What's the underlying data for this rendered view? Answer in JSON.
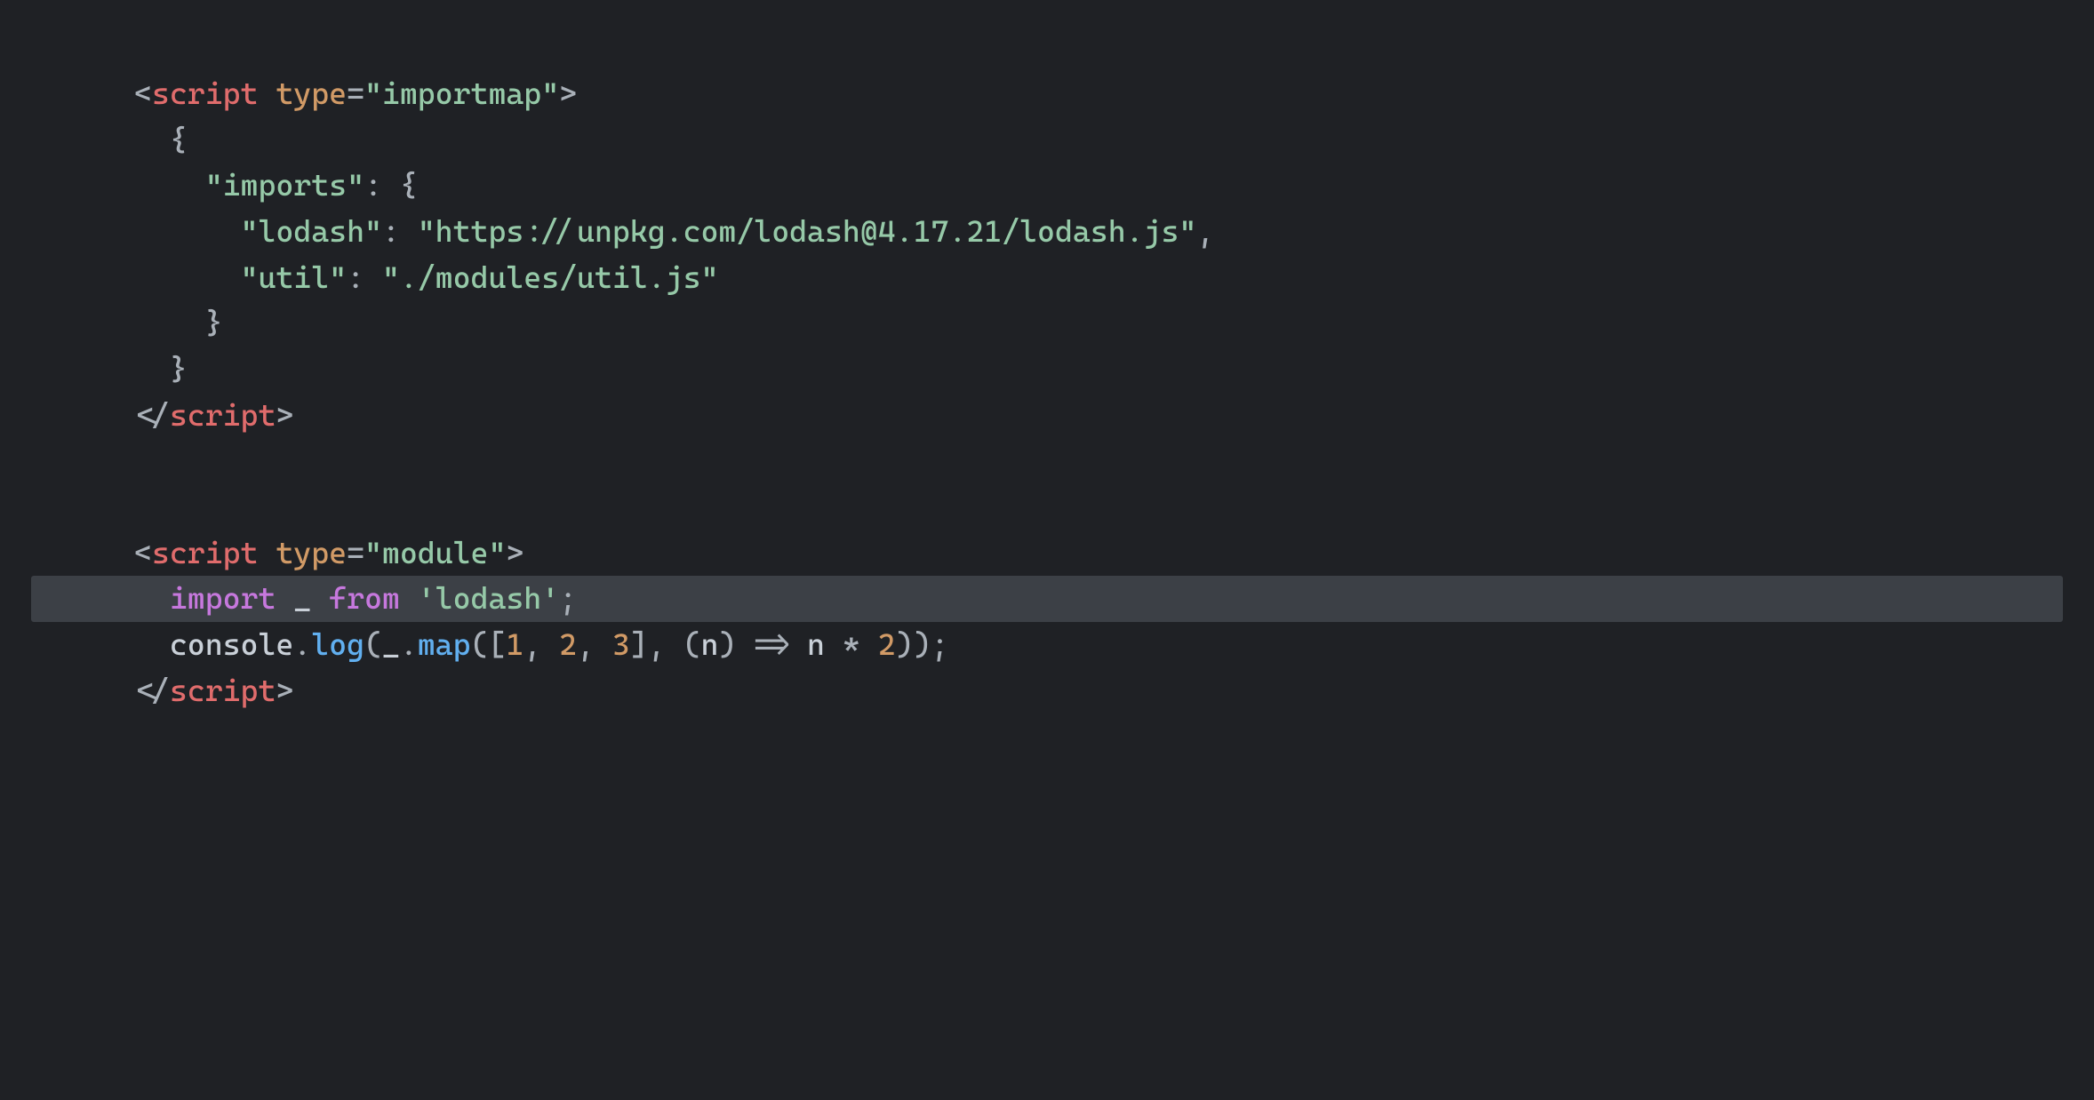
{
  "code": {
    "lines": [
      {
        "highlight": false,
        "tokens": [
          {
            "cls": "tok-punct",
            "t": "<"
          },
          {
            "cls": "tok-tag",
            "t": "script"
          },
          {
            "cls": "tok-ident",
            "t": " "
          },
          {
            "cls": "tok-attr",
            "t": "type"
          },
          {
            "cls": "tok-punct",
            "t": "="
          },
          {
            "cls": "tok-string",
            "t": "\"importmap\""
          },
          {
            "cls": "tok-punct",
            "t": ">"
          }
        ]
      },
      {
        "highlight": false,
        "tokens": [
          {
            "cls": "tok-ident",
            "t": "  "
          },
          {
            "cls": "tok-punct",
            "t": "{"
          }
        ]
      },
      {
        "highlight": false,
        "tokens": [
          {
            "cls": "tok-ident",
            "t": "    "
          },
          {
            "cls": "tok-string",
            "t": "\"imports\""
          },
          {
            "cls": "tok-punct",
            "t": ":"
          },
          {
            "cls": "tok-ident",
            "t": " "
          },
          {
            "cls": "tok-punct",
            "t": "{"
          }
        ]
      },
      {
        "highlight": false,
        "tokens": [
          {
            "cls": "tok-ident",
            "t": "      "
          },
          {
            "cls": "tok-string",
            "t": "\"lodash\""
          },
          {
            "cls": "tok-punct",
            "t": ":"
          },
          {
            "cls": "tok-ident",
            "t": " "
          },
          {
            "cls": "tok-string",
            "t": "\"https://unpkg.com/lodash@4.17.21/lodash.js\""
          },
          {
            "cls": "tok-punct",
            "t": ","
          }
        ]
      },
      {
        "highlight": false,
        "tokens": [
          {
            "cls": "tok-ident",
            "t": "      "
          },
          {
            "cls": "tok-string",
            "t": "\"util\""
          },
          {
            "cls": "tok-punct",
            "t": ":"
          },
          {
            "cls": "tok-ident",
            "t": " "
          },
          {
            "cls": "tok-string",
            "t": "\"./modules/util.js\""
          }
        ]
      },
      {
        "highlight": false,
        "tokens": [
          {
            "cls": "tok-ident",
            "t": "    "
          },
          {
            "cls": "tok-punct",
            "t": "}"
          }
        ]
      },
      {
        "highlight": false,
        "tokens": [
          {
            "cls": "tok-ident",
            "t": "  "
          },
          {
            "cls": "tok-punct",
            "t": "}"
          }
        ]
      },
      {
        "highlight": false,
        "tokens": [
          {
            "cls": "tok-punct",
            "t": "</"
          },
          {
            "cls": "tok-tag",
            "t": "script"
          },
          {
            "cls": "tok-punct",
            "t": ">"
          }
        ]
      },
      {
        "highlight": false,
        "tokens": [
          {
            "cls": "tok-ident",
            "t": ""
          }
        ]
      },
      {
        "highlight": false,
        "tokens": [
          {
            "cls": "tok-ident",
            "t": ""
          }
        ]
      },
      {
        "highlight": false,
        "tokens": [
          {
            "cls": "tok-punct",
            "t": "<"
          },
          {
            "cls": "tok-tag",
            "t": "script"
          },
          {
            "cls": "tok-ident",
            "t": " "
          },
          {
            "cls": "tok-attr",
            "t": "type"
          },
          {
            "cls": "tok-punct",
            "t": "="
          },
          {
            "cls": "tok-string",
            "t": "\"module\""
          },
          {
            "cls": "tok-punct",
            "t": ">"
          }
        ]
      },
      {
        "highlight": true,
        "tokens": [
          {
            "cls": "tok-ident",
            "t": "  "
          },
          {
            "cls": "tok-keyword",
            "t": "import"
          },
          {
            "cls": "tok-ident",
            "t": " _ "
          },
          {
            "cls": "tok-keyword",
            "t": "from"
          },
          {
            "cls": "tok-ident",
            "t": " "
          },
          {
            "cls": "tok-string",
            "t": "'lodash'"
          },
          {
            "cls": "tok-punct",
            "t": ";"
          }
        ]
      },
      {
        "highlight": false,
        "tokens": [
          {
            "cls": "tok-ident",
            "t": "  "
          },
          {
            "cls": "tok-ident",
            "t": "console"
          },
          {
            "cls": "tok-punct",
            "t": "."
          },
          {
            "cls": "tok-func",
            "t": "log"
          },
          {
            "cls": "tok-punct",
            "t": "("
          },
          {
            "cls": "tok-ident",
            "t": "_"
          },
          {
            "cls": "tok-punct",
            "t": "."
          },
          {
            "cls": "tok-func",
            "t": "map"
          },
          {
            "cls": "tok-punct",
            "t": "(["
          },
          {
            "cls": "tok-num",
            "t": "1"
          },
          {
            "cls": "tok-punct",
            "t": ", "
          },
          {
            "cls": "tok-num",
            "t": "2"
          },
          {
            "cls": "tok-punct",
            "t": ", "
          },
          {
            "cls": "tok-num",
            "t": "3"
          },
          {
            "cls": "tok-punct",
            "t": "], ("
          },
          {
            "cls": "tok-ident",
            "t": "n"
          },
          {
            "cls": "tok-punct",
            "t": ") "
          },
          {
            "cls": "tok-punct",
            "t": "=>"
          },
          {
            "cls": "tok-ident",
            "t": " n "
          },
          {
            "cls": "tok-punct",
            "t": "*"
          },
          {
            "cls": "tok-ident",
            "t": " "
          },
          {
            "cls": "tok-num",
            "t": "2"
          },
          {
            "cls": "tok-punct",
            "t": "));"
          }
        ]
      },
      {
        "highlight": false,
        "tokens": [
          {
            "cls": "tok-punct",
            "t": "</"
          },
          {
            "cls": "tok-tag",
            "t": "script"
          },
          {
            "cls": "tok-punct",
            "t": ">"
          }
        ]
      }
    ]
  }
}
